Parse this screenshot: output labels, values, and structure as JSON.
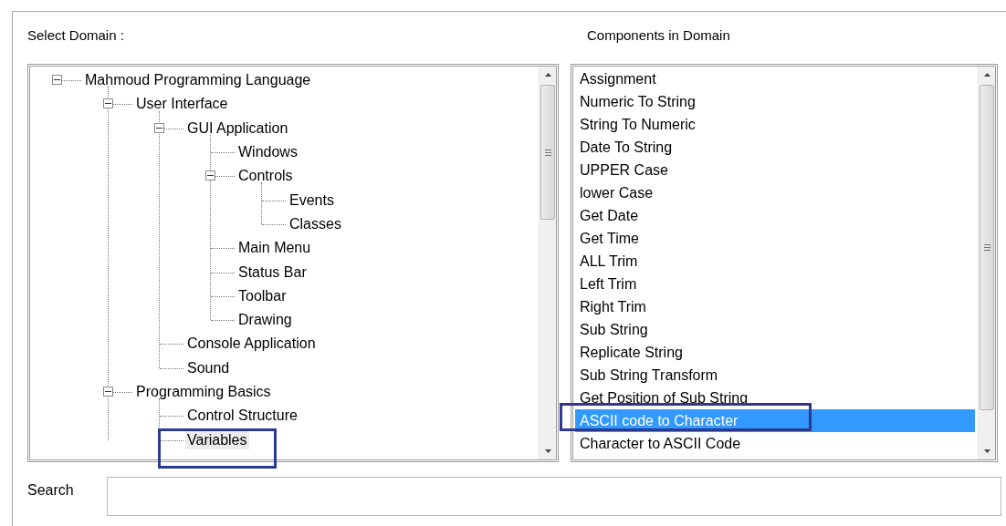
{
  "domain_label": "Select Domain :",
  "components_label": "Components in Domain",
  "tree": [
    {
      "label": "Mahmoud Programming Language",
      "expanded": true,
      "selected": false,
      "children": [
        {
          "label": "User Interface",
          "expanded": true,
          "selected": false,
          "children": [
            {
              "label": "GUI Application",
              "expanded": true,
              "selected": false,
              "children": [
                {
                  "label": "Windows",
                  "selected": false
                },
                {
                  "label": "Controls",
                  "expanded": true,
                  "selected": false,
                  "children": [
                    {
                      "label": "Events",
                      "selected": false
                    },
                    {
                      "label": "Classes",
                      "selected": false
                    }
                  ]
                },
                {
                  "label": "Main Menu",
                  "selected": false
                },
                {
                  "label": "Status Bar",
                  "selected": false
                },
                {
                  "label": "Toolbar",
                  "selected": false
                },
                {
                  "label": "Drawing",
                  "selected": false
                }
              ]
            },
            {
              "label": "Console Application",
              "selected": false
            },
            {
              "label": "Sound",
              "selected": false
            }
          ]
        },
        {
          "label": "Programming Basics",
          "expanded": true,
          "selected": false,
          "children": [
            {
              "label": "Control Structure",
              "selected": false
            },
            {
              "label": "Variables",
              "selected": true,
              "marked": true
            }
          ]
        }
      ]
    }
  ],
  "components": [
    {
      "label": "Assignment",
      "selected": false
    },
    {
      "label": "Numeric To String",
      "selected": false
    },
    {
      "label": "String To Numeric",
      "selected": false
    },
    {
      "label": "Date To String",
      "selected": false
    },
    {
      "label": "UPPER Case",
      "selected": false
    },
    {
      "label": "lower Case",
      "selected": false
    },
    {
      "label": "Get Date",
      "selected": false
    },
    {
      "label": "Get Time",
      "selected": false
    },
    {
      "label": "ALL Trim",
      "selected": false
    },
    {
      "label": "Left Trim",
      "selected": false
    },
    {
      "label": "Right Trim",
      "selected": false
    },
    {
      "label": "Sub String",
      "selected": false
    },
    {
      "label": "Replicate String",
      "selected": false
    },
    {
      "label": "Sub String Transform",
      "selected": false
    },
    {
      "label": "Get Position of Sub String",
      "selected": false
    },
    {
      "label": "ASCII code to Character",
      "selected": true,
      "marked": true
    },
    {
      "label": "Character to ASCII Code",
      "selected": false
    }
  ],
  "search": {
    "label": "Search"
  }
}
